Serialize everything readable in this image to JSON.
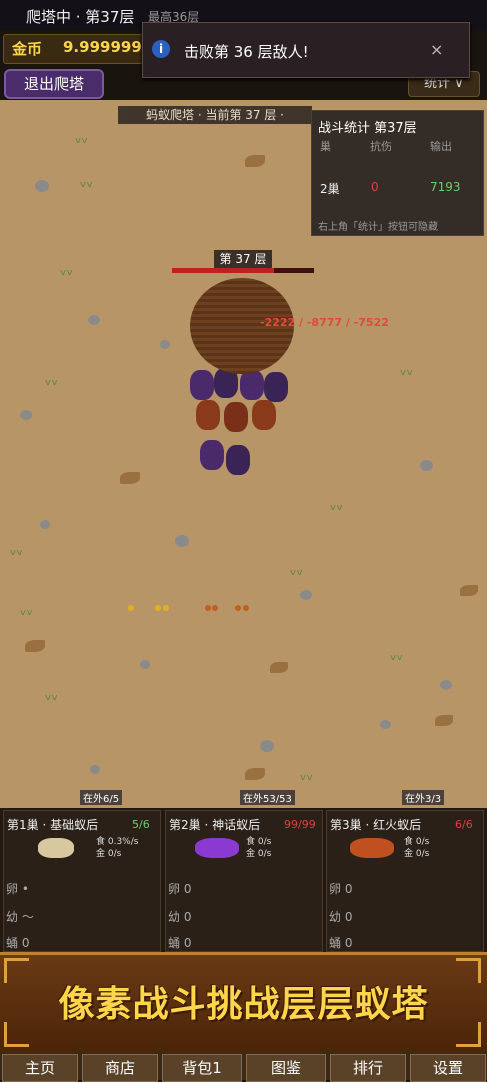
{
  "header": {
    "title": "爬塔中 · 第37层",
    "best": "最高36层",
    "coin_label": "金币",
    "coin_value": "9.999999",
    "exit_button": "退出爬塔",
    "stats_button": "统计 ∨"
  },
  "toast": {
    "icon": "i",
    "message": "击败第 36 层敌人!",
    "close": "×"
  },
  "field": {
    "tower_label": "蚂蚁爬塔 · 当前第 37 层 ·",
    "floor_tag": "第 37 层",
    "enemy_hp_fraction": 0.72,
    "damage_text": "-2222 / -8777 / -7522",
    "tunnels": [
      "在外6/5",
      "在外53/53",
      "在外3/3"
    ]
  },
  "battle_stats": {
    "title": "战斗统计 第37层",
    "headers": [
      "巢",
      "抗伤",
      "输出"
    ],
    "rows": [
      {
        "nest": "2巢",
        "tank": "0",
        "damage": "7193"
      }
    ],
    "footer": "右上角「统计」按钮可隐藏"
  },
  "nests": [
    {
      "title": "第1巢 · 基础蚁后",
      "count": "5/6",
      "count_color": "#6ad06a",
      "body_color": "#d8c8a0",
      "rate1": "食 0.3%/s",
      "rate2": "金 0/s",
      "rows": [
        "卵 •",
        "幼 〜",
        "蛹 0"
      ]
    },
    {
      "title": "第2巢 · 神话蚁后",
      "count": "99/99",
      "count_color": "#e04040",
      "body_color": "#8a3ad0",
      "rate1": "食 0/s",
      "rate2": "金 0/s",
      "rows": [
        "卵 0",
        "幼 0",
        "蛹 0"
      ]
    },
    {
      "title": "第3巢 · 红火蚁后",
      "count": "6/6",
      "count_color": "#e04040",
      "body_color": "#c05020",
      "rate1": "食 0/s",
      "rate2": "金 0/s",
      "rows": [
        "卵 0",
        "幼 0",
        "蛹 0"
      ]
    }
  ],
  "banner": {
    "text": "像素战斗挑战层层蚁塔"
  },
  "nav": [
    "主页",
    "商店",
    "背包1",
    "图鉴",
    "排行",
    "设置"
  ]
}
